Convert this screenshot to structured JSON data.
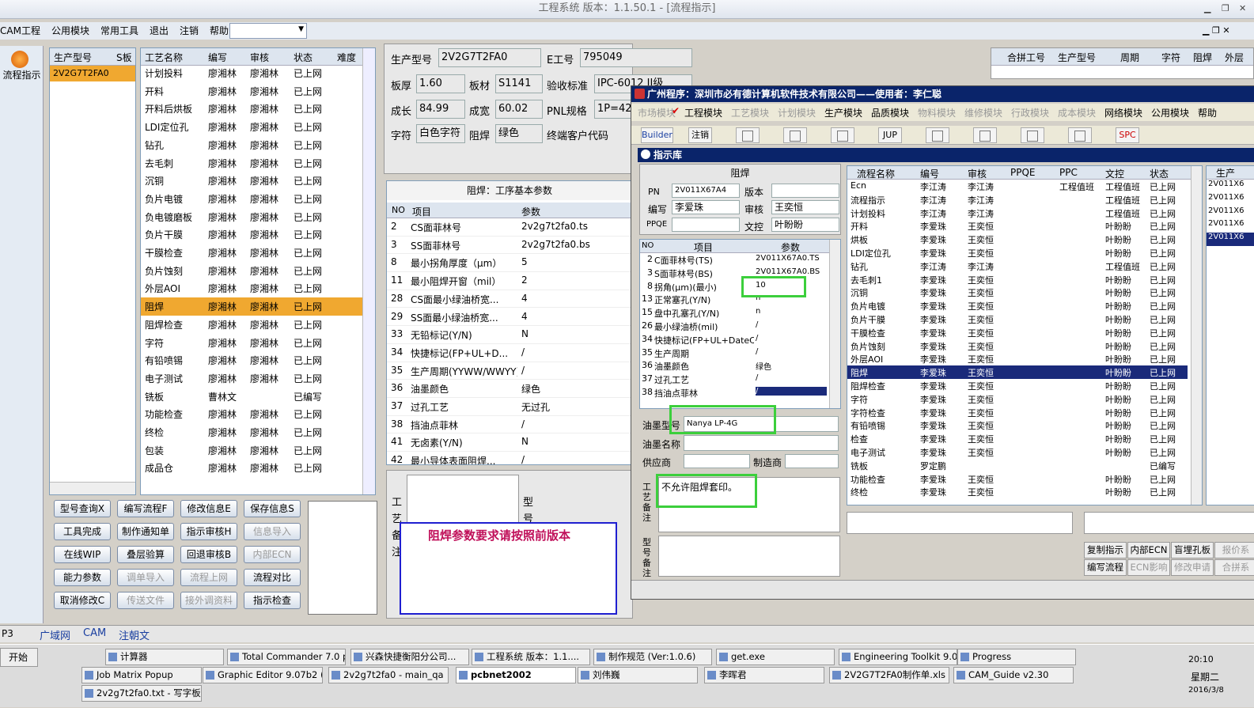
{
  "window": {
    "title": "工程系统  版本：1.1.50.1 - [流程指示]"
  },
  "menu": [
    "CAM工程",
    "公用模块",
    "常用工具",
    "退出",
    "注销",
    "帮助"
  ],
  "left_nav": {
    "label": "流程指示"
  },
  "product_list": {
    "headers": [
      "生产型号",
      "S板"
    ],
    "items": [
      "2V2G7T2FA0"
    ]
  },
  "process_list": {
    "headers": [
      "工艺名称",
      "编写",
      "审核",
      "状态",
      "难度"
    ],
    "rows": [
      [
        "计划投料",
        "廖湘林",
        "廖湘林",
        "已上网"
      ],
      [
        "开料",
        "廖湘林",
        "廖湘林",
        "已上网"
      ],
      [
        "开料后烘板",
        "廖湘林",
        "廖湘林",
        "已上网"
      ],
      [
        "LDI定位孔",
        "廖湘林",
        "廖湘林",
        "已上网"
      ],
      [
        "钻孔",
        "廖湘林",
        "廖湘林",
        "已上网"
      ],
      [
        "去毛刺",
        "廖湘林",
        "廖湘林",
        "已上网"
      ],
      [
        "沉铜",
        "廖湘林",
        "廖湘林",
        "已上网"
      ],
      [
        "负片电镀",
        "廖湘林",
        "廖湘林",
        "已上网"
      ],
      [
        "负电镀磨板",
        "廖湘林",
        "廖湘林",
        "已上网"
      ],
      [
        "负片干膜",
        "廖湘林",
        "廖湘林",
        "已上网"
      ],
      [
        "干膜检查",
        "廖湘林",
        "廖湘林",
        "已上网"
      ],
      [
        "负片蚀刻",
        "廖湘林",
        "廖湘林",
        "已上网"
      ],
      [
        "外层AOI",
        "廖湘林",
        "廖湘林",
        "已上网"
      ],
      [
        "阻焊",
        "廖湘林",
        "廖湘林",
        "已上网"
      ],
      [
        "阻焊检查",
        "廖湘林",
        "廖湘林",
        "已上网"
      ],
      [
        "字符",
        "廖湘林",
        "廖湘林",
        "已上网"
      ],
      [
        "有铅喷锡",
        "廖湘林",
        "廖湘林",
        "已上网"
      ],
      [
        "电子测试",
        "廖湘林",
        "廖湘林",
        "已上网"
      ],
      [
        "铣板",
        "曹林文",
        "",
        "已编写"
      ],
      [
        "功能检查",
        "廖湘林",
        "廖湘林",
        "已上网"
      ],
      [
        "终检",
        "廖湘林",
        "廖湘林",
        "已上网"
      ],
      [
        "包装",
        "廖湘林",
        "廖湘林",
        "已上网"
      ],
      [
        "成品仓",
        "廖湘林",
        "廖湘林",
        "已上网"
      ]
    ],
    "selected": "阻焊"
  },
  "buttons": [
    [
      "型号查询X",
      "编写流程F",
      "修改信息E",
      "保存信息S"
    ],
    [
      "工具完成",
      "制作通知单",
      "指示审核H",
      "信息导入"
    ],
    [
      "在线WIP",
      "叠层验算",
      "回退审核B",
      "内部ECN"
    ],
    [
      "能力参数",
      "调单导入",
      "流程上网",
      "流程对比"
    ],
    [
      "取消修改C",
      "传送文件",
      "接外调资料",
      "指示检查"
    ]
  ],
  "disabled_buttons": [
    "信息导入",
    "内部ECN",
    "调单导入",
    "流程上网",
    "传送文件",
    "接外调资料"
  ],
  "header_info": {
    "prod_label": "生产型号",
    "prod": "2V2G7T2FA0",
    "e_label": "E工号",
    "e": "795049",
    "thick_label": "板厚",
    "thick": "1.60",
    "mat_label": "板材",
    "mat": "S1141",
    "std_label": "验收标准",
    "std": "IPC-6012 II级",
    "len_label": "成长",
    "len": "84.99",
    "wid_label": "成宽",
    "wid": "60.02",
    "pnl_label": "PNL规格",
    "pnl": "1P=42",
    "char_label": "字符",
    "char": "白色字符",
    "sm_label": "阻焊",
    "sm": "绿色",
    "cust_label": "终端客户代码"
  },
  "right_top_headers": [
    "合拼工号",
    "生产型号",
    "周期",
    "字符",
    "阻焊",
    "外层"
  ],
  "param_section": {
    "title": "阻焊：工序基本参数",
    "headers": [
      "NO",
      "项目",
      "参数"
    ],
    "rows": [
      [
        "2",
        "CS面菲林号",
        "2v2g7t2fa0.ts"
      ],
      [
        "3",
        "SS面菲林号",
        "2v2g7t2fa0.bs"
      ],
      [
        "8",
        "最小拐角厚度（μm）",
        "5"
      ],
      [
        "11",
        "最小阻焊开窗（mil）",
        "2"
      ],
      [
        "28",
        "CS面最小绿油桥宽...",
        "4"
      ],
      [
        "29",
        "SS面最小绿油桥宽...",
        "4"
      ],
      [
        "33",
        "无铅标记(Y/N)",
        "N"
      ],
      [
        "34",
        "快捷标记(FP+UL+D...",
        "/"
      ],
      [
        "35",
        "生产周期(YYWW/WWYY)",
        "/"
      ],
      [
        "36",
        "油墨颜色",
        "绿色"
      ],
      [
        "37",
        "过孔工艺",
        "无过孔"
      ],
      [
        "38",
        "挡油点菲林",
        "/"
      ],
      [
        "41",
        "无卤素(Y/N)",
        "N"
      ],
      [
        "42",
        "最小导体表面阻焊...",
        "/"
      ]
    ]
  },
  "bottom_labels": {
    "a": "工艺备注",
    "b": "型号"
  },
  "notice": "阻焊参数要求请按照前版本",
  "overlay": {
    "title": "广州程序：深圳市必有德计算机软件技术有限公司——使用者：李仁聪",
    "menu": [
      "市场模块",
      "工程模块",
      "工艺模块",
      "计划模块",
      "生产模块",
      "品质模块",
      "物料模块",
      "维修模块",
      "行政模块",
      "成本模块",
      "网络模块",
      "公用模块",
      "帮助"
    ],
    "menu_dim": [
      "市场模块",
      "工艺模块",
      "计划模块",
      "物料模块",
      "维修模块",
      "行政模块",
      "成本模块"
    ],
    "toolbar": [
      "Builder",
      "注销",
      "",
      "",
      "",
      "JUP",
      "",
      "",
      "",
      "",
      "SPC"
    ],
    "lib_title": "指示库",
    "sm_box": {
      "title": "阻焊",
      "pn_label": "PN",
      "pn": "2V011X67A4",
      "ver_label": "版本",
      "ver": "",
      "by_label": "编写",
      "by": "李爱珠",
      "rev_label": "审核",
      "rev": "王奕恒",
      "ppqe_label": "PPQE",
      "ppqe": "",
      "doc_label": "文控",
      "doc": "叶盼盼"
    },
    "params_headers": [
      "NO",
      "项目",
      "参数"
    ],
    "params": [
      [
        "2",
        "C面菲林号(TS)",
        "2V011X67A0.TS"
      ],
      [
        "3",
        "S面菲林号(BS)",
        "2V011X67A0.BS"
      ],
      [
        "8",
        "拐角(μm)(最小)",
        "10"
      ],
      [
        "13",
        "正常塞孔(Y/N)",
        "n"
      ],
      [
        "15",
        "盘中孔塞孔(Y/N)",
        "n"
      ],
      [
        "26",
        "最小绿油桥(mil)",
        "/"
      ],
      [
        "34",
        "快捷标记(FP+UL+DateCo",
        "/"
      ],
      [
        "35",
        "生产周期",
        "/"
      ],
      [
        "36",
        "油墨颜色",
        "绿色"
      ],
      [
        "37",
        "过孔工艺",
        "/"
      ],
      [
        "38",
        "挡油点菲林",
        "/"
      ]
    ],
    "ink_label": "油墨型号",
    "ink": "Nanya LP-4G",
    "ink_name_label": "油墨名称",
    "supplier_label": "供应商",
    "maker_label": "制造商",
    "note_label": "工艺备注",
    "note": "不允许阻焊套印。",
    "note2_label": "型号备注",
    "flow_headers": [
      "流程名称",
      "编号",
      "审核",
      "PPQE",
      "PPC",
      "文控",
      "状态"
    ],
    "flow": [
      [
        "Ecn",
        "李江涛",
        "李江涛",
        "",
        "工程值班",
        "工程值班",
        "已上网"
      ],
      [
        "流程指示",
        "李江涛",
        "李江涛",
        "",
        "",
        "工程值班",
        "已上网"
      ],
      [
        "计划投料",
        "李江涛",
        "李江涛",
        "",
        "",
        "工程值班",
        "已上网"
      ],
      [
        "开料",
        "李爱珠",
        "王奕恒",
        "",
        "",
        "叶盼盼",
        "已上网"
      ],
      [
        "烘板",
        "李爱珠",
        "王奕恒",
        "",
        "",
        "叶盼盼",
        "已上网"
      ],
      [
        "LDI定位孔",
        "李爱珠",
        "王奕恒",
        "",
        "",
        "叶盼盼",
        "已上网"
      ],
      [
        "钻孔",
        "李江涛",
        "李江涛",
        "",
        "",
        "工程值班",
        "已上网"
      ],
      [
        "去毛刺1",
        "李爱珠",
        "王奕恒",
        "",
        "",
        "叶盼盼",
        "已上网"
      ],
      [
        "沉铜",
        "李爱珠",
        "王奕恒",
        "",
        "",
        "叶盼盼",
        "已上网"
      ],
      [
        "负片电镀",
        "李爱珠",
        "王奕恒",
        "",
        "",
        "叶盼盼",
        "已上网"
      ],
      [
        "负片干膜",
        "李爱珠",
        "王奕恒",
        "",
        "",
        "叶盼盼",
        "已上网"
      ],
      [
        "干膜检查",
        "李爱珠",
        "王奕恒",
        "",
        "",
        "叶盼盼",
        "已上网"
      ],
      [
        "负片蚀刻",
        "李爱珠",
        "王奕恒",
        "",
        "",
        "叶盼盼",
        "已上网"
      ],
      [
        "外层AOI",
        "李爱珠",
        "王奕恒",
        "",
        "",
        "叶盼盼",
        "已上网"
      ],
      [
        "阻焊",
        "李爱珠",
        "王奕恒",
        "",
        "",
        "叶盼盼",
        "已上网"
      ],
      [
        "阻焊检查",
        "李爱珠",
        "王奕恒",
        "",
        "",
        "叶盼盼",
        "已上网"
      ],
      [
        "字符",
        "李爱珠",
        "王奕恒",
        "",
        "",
        "叶盼盼",
        "已上网"
      ],
      [
        "字符检查",
        "李爱珠",
        "王奕恒",
        "",
        "",
        "叶盼盼",
        "已上网"
      ],
      [
        "有铅喷锡",
        "李爱珠",
        "王奕恒",
        "",
        "",
        "叶盼盼",
        "已上网"
      ],
      [
        "检查",
        "李爱珠",
        "王奕恒",
        "",
        "",
        "叶盼盼",
        "已上网"
      ],
      [
        "电子测试",
        "李爱珠",
        "王奕恒",
        "",
        "",
        "叶盼盼",
        "已上网"
      ],
      [
        "铣板",
        "罗定鹏",
        "",
        "",
        "",
        "",
        "已编写"
      ],
      [
        "功能检查",
        "李爱珠",
        "王奕恒",
        "",
        "",
        "叶盼盼",
        "已上网"
      ],
      [
        "终检",
        "李爱珠",
        "王奕恒",
        "",
        "",
        "叶盼盼",
        "已上网"
      ]
    ],
    "flow_selected": "阻焊",
    "side_header": "生产",
    "side_items": [
      "2V011X6",
      "2V011X6",
      "2V011X6",
      "2V011X6",
      "2V011X6"
    ],
    "bottom_buttons": [
      "复制指示",
      "内部ECN",
      "盲埋孔板",
      "报价系",
      "编写流程",
      "ECN影响",
      "修改申请",
      "合拼系"
    ]
  },
  "bottom_tabs": [
    "P3",
    "广域网",
    "CAM",
    "注朝文"
  ],
  "taskbar": {
    "start": "开始",
    "row1": [
      "计算器",
      "Total Commander 7.0 p...",
      "兴森快捷衡阳分公司...",
      "工程系统  版本：1.1....",
      "制作规范 (Ver:1.0.6)",
      "get.exe",
      "Engineering Toolkit 9.0...",
      "Progress"
    ],
    "row2": [
      "Job Matrix Popup",
      "Graphic Editor 9.07b2 (0...",
      "2v2g7t2fa0 - main_qa",
      "pcbnet2002",
      "刘伟巍",
      "李晖君",
      "2V2G7T2FA0制作单.xls ...",
      "CAM_Guide v2.30"
    ],
    "row3": [
      "2v2g7t2fa0.txt - 写字板"
    ],
    "time": "20:10",
    "day": "星期二",
    "date": "2016/3/8"
  }
}
